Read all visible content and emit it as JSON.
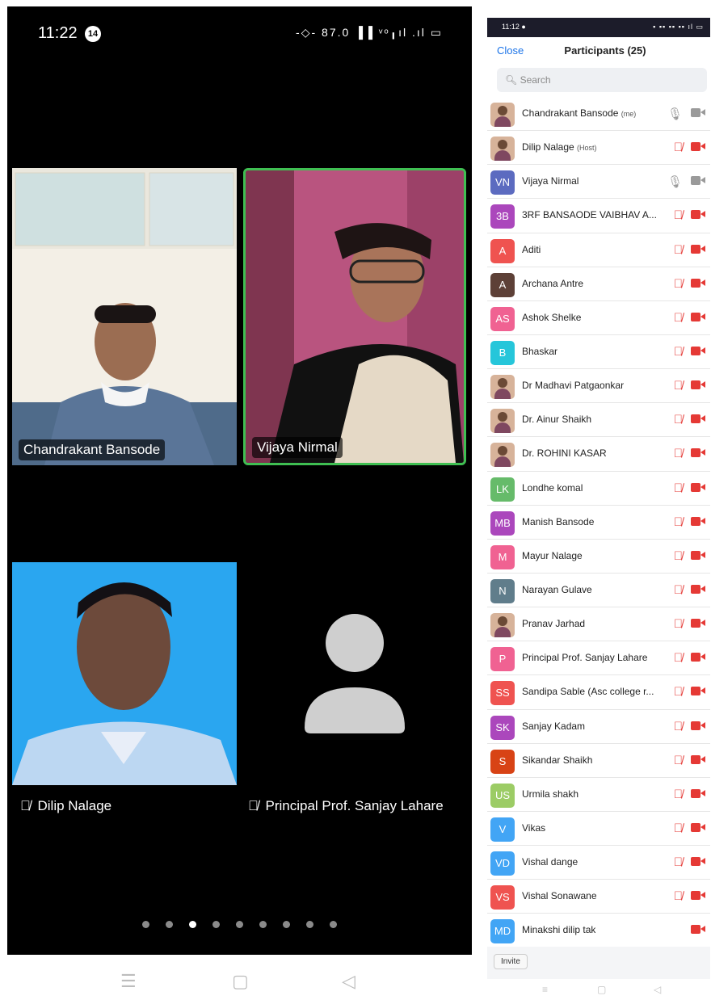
{
  "left_phone": {
    "status": {
      "time": "11:22",
      "badge": "14",
      "icons": "-◇- 87.0 ▐▐ ᵛᵒ╻ıl .ıl ▭"
    },
    "tiles": [
      {
        "name": "Chandrakant Bansode"
      },
      {
        "name": "Vijaya Nirmal"
      },
      {
        "name": "Dilip Nalage",
        "mic_off_icon": "mic-off-icon"
      },
      {
        "name": "Principal  Prof.  Sanjay Lahare",
        "mic_off_icon": "mic-off-icon"
      }
    ],
    "page_dots": {
      "count": 9,
      "active": 3
    },
    "nav": {
      "menu": "☰",
      "home": "▢",
      "back": "◁"
    }
  },
  "right_phone": {
    "status": {
      "time": "11:12 ●",
      "icons": "▪ ▪▪ ▪▪ ▪▪ ıl ▭"
    },
    "close_label": "Close",
    "title": "Participants (25)",
    "search_placeholder": "Search",
    "participants": [
      {
        "initials": "",
        "name": "Chandrakant Bansode",
        "tag": "(me)",
        "color": "",
        "photo": true,
        "mic": "on",
        "video": "on"
      },
      {
        "initials": "",
        "name": "Dilip Nalage",
        "tag": "(Host)",
        "color": "",
        "photo": true,
        "mic": "off",
        "video": "off"
      },
      {
        "initials": "VN",
        "name": "Vijaya Nirmal",
        "tag": "",
        "color": "#5c6bc0",
        "photo": false,
        "mic": "on",
        "video": "on"
      },
      {
        "initials": "3B",
        "name": "3RF BANSAODE VAIBHAV A...",
        "tag": "",
        "color": "#ab47bc",
        "photo": false,
        "mic": "off",
        "video": "off"
      },
      {
        "initials": "A",
        "name": "Aditi",
        "tag": "",
        "color": "#ef5350",
        "photo": false,
        "mic": "off",
        "video": "off"
      },
      {
        "initials": "A",
        "name": "Archana Antre",
        "tag": "",
        "color": "#5d4037",
        "photo": false,
        "mic": "off",
        "video": "off"
      },
      {
        "initials": "AS",
        "name": "Ashok Shelke",
        "tag": "",
        "color": "#f06292",
        "photo": false,
        "mic": "off",
        "video": "off"
      },
      {
        "initials": "B",
        "name": "Bhaskar",
        "tag": "",
        "color": "#26c6da",
        "photo": false,
        "mic": "off",
        "video": "off"
      },
      {
        "initials": "",
        "name": "Dr Madhavi Patgaonkar",
        "tag": "",
        "color": "",
        "photo": true,
        "mic": "off",
        "video": "off"
      },
      {
        "initials": "",
        "name": "Dr. Ainur Shaikh",
        "tag": "",
        "color": "",
        "photo": true,
        "mic": "off",
        "video": "off"
      },
      {
        "initials": "",
        "name": "Dr. ROHINI KASAR",
        "tag": "",
        "color": "",
        "photo": true,
        "mic": "off",
        "video": "off"
      },
      {
        "initials": "LK",
        "name": "Londhe komal",
        "tag": "",
        "color": "#66bb6a",
        "photo": false,
        "mic": "off",
        "video": "off"
      },
      {
        "initials": "MB",
        "name": "Manish Bansode",
        "tag": "",
        "color": "#ab47bc",
        "photo": false,
        "mic": "off",
        "video": "off"
      },
      {
        "initials": "M",
        "name": "Mayur  Nalage",
        "tag": "",
        "color": "#f06292",
        "photo": false,
        "mic": "off",
        "video": "off"
      },
      {
        "initials": "N",
        "name": "Narayan Gulave",
        "tag": "",
        "color": "#607d8b",
        "photo": false,
        "mic": "off",
        "video": "off"
      },
      {
        "initials": "",
        "name": "Pranav Jarhad",
        "tag": "",
        "color": "",
        "photo": true,
        "mic": "off",
        "video": "off"
      },
      {
        "initials": "P",
        "name": "Principal  Prof.  Sanjay Lahare",
        "tag": "",
        "color": "#f06292",
        "photo": false,
        "mic": "off",
        "video": "off"
      },
      {
        "initials": "SS",
        "name": "Sandipa Sable (Asc college r...",
        "tag": "",
        "color": "#ef5350",
        "photo": false,
        "mic": "off",
        "video": "off"
      },
      {
        "initials": "SK",
        "name": "Sanjay Kadam",
        "tag": "",
        "color": "#ab47bc",
        "photo": false,
        "mic": "off",
        "video": "off"
      },
      {
        "initials": "S",
        "name": "Sikandar Shaikh",
        "tag": "",
        "color": "#d84315",
        "photo": false,
        "mic": "off",
        "video": "off"
      },
      {
        "initials": "US",
        "name": "Urmila shakh",
        "tag": "",
        "color": "#9ccc65",
        "photo": false,
        "mic": "off",
        "video": "off"
      },
      {
        "initials": "V",
        "name": "Vikas",
        "tag": "",
        "color": "#42a5f5",
        "photo": false,
        "mic": "off",
        "video": "off"
      },
      {
        "initials": "VD",
        "name": "Vishal dange",
        "tag": "",
        "color": "#42a5f5",
        "photo": false,
        "mic": "off",
        "video": "off"
      },
      {
        "initials": "VS",
        "name": "Vishal Sonawane",
        "tag": "",
        "color": "#ef5350",
        "photo": false,
        "mic": "off",
        "video": "off"
      },
      {
        "initials": "MD",
        "name": "Minakshi dilip tak",
        "tag": "",
        "color": "#42a5f5",
        "photo": false,
        "mic": "none",
        "video": "off"
      }
    ],
    "invite_label": "Invite",
    "nav": {
      "menu": "≡",
      "home": "▢",
      "back": "◁"
    }
  }
}
